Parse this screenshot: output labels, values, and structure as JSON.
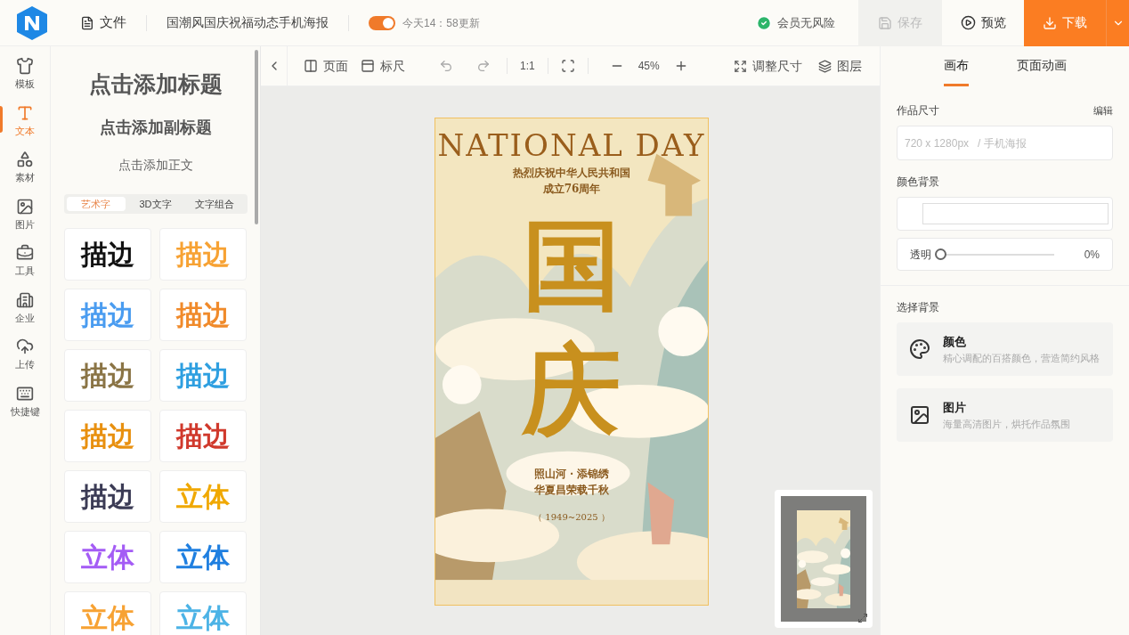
{
  "header": {
    "file_menu": "文件",
    "doc_title": "国潮风国庆祝福动态手机海报",
    "autosave": {
      "on": true,
      "label": "今天14：58更新"
    },
    "member": "会员无风险",
    "save": {
      "label": "保存",
      "disabled": true
    },
    "preview": "预览",
    "download": "下载"
  },
  "rail": [
    {
      "label": "模板",
      "selected": false
    },
    {
      "label": "文本",
      "selected": true
    },
    {
      "label": "素材",
      "selected": false
    },
    {
      "label": "图片",
      "selected": false
    },
    {
      "label": "工具",
      "selected": false
    },
    {
      "label": "企业",
      "selected": false
    },
    {
      "label": "上传",
      "selected": false
    },
    {
      "label": "快捷键",
      "selected": false
    }
  ],
  "text_panel": {
    "title": "点击添加标题",
    "subtitle": "点击添加副标题",
    "body": "点击添加正文",
    "tabs": [
      {
        "label": "艺术字",
        "selected": true
      },
      {
        "label": "3D文字",
        "selected": false
      },
      {
        "label": "文字组合",
        "selected": false
      }
    ],
    "tiles": [
      {
        "text": "描边",
        "color": "#111111"
      },
      {
        "text": "描边",
        "color": "#f7a233"
      },
      {
        "text": "描边",
        "color": "#4a9cf0"
      },
      {
        "text": "描边",
        "color": "#f08a2a"
      },
      {
        "text": "描边",
        "color": "#8a7445"
      },
      {
        "text": "描边",
        "color": "#2e9fe0"
      },
      {
        "text": "描边",
        "color": "#e8900f"
      },
      {
        "text": "描边",
        "color": "#d0392c"
      },
      {
        "text": "描边",
        "color": "#3b3b55"
      },
      {
        "text": "立体",
        "color": "#f0a800"
      },
      {
        "text": "立体",
        "color": "#a45cf5"
      },
      {
        "text": "立体",
        "color": "#1f7fe0"
      },
      {
        "text": "立体",
        "color": "#f7a233"
      },
      {
        "text": "立体",
        "color": "#4cb3e6"
      }
    ]
  },
  "toolbar": {
    "page": "页面",
    "ruler": "标尺",
    "ratio": "1:1",
    "zoom": "45%",
    "resize": "调整尺寸",
    "layers": "图层"
  },
  "poster": {
    "heading": "NATIONAL DAY",
    "line_1": "热烈庆祝中华人民共和国",
    "line_2": "成立76周年",
    "big_1": "国",
    "big_2": "庆",
    "verse_1": "照山河 · 添锦绣",
    "verse_2": "华夏昌荣载千秋",
    "years": "（ 1949~2025 ）"
  },
  "right_panel": {
    "tabs": [
      {
        "label": "画布",
        "selected": true
      },
      {
        "label": "页面动画",
        "selected": false
      }
    ],
    "size_label": "作品尺寸",
    "edit": "编辑",
    "size_value": "720 x 1280px",
    "size_kind": "/ 手机海报",
    "color_bg_label": "颜色背景",
    "opacity": {
      "label": "透明",
      "level": 0,
      "reading": "0%"
    },
    "choose_label": "选择背景",
    "options": [
      {
        "title": "颜色",
        "desc": "精心调配的百搭颜色，营造简约风格"
      },
      {
        "title": "图片",
        "desc": "海量高清图片，烘托作品氛围"
      }
    ]
  }
}
